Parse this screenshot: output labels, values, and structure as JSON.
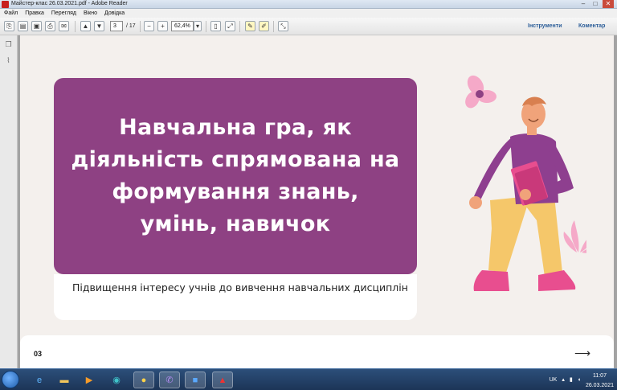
{
  "window": {
    "title": "Майстер-клас 26.03.2021.pdf - Adobe Reader",
    "controls": [
      "–",
      "□",
      "✕"
    ]
  },
  "menu": [
    "Файл",
    "Правка",
    "Перегляд",
    "Вікно",
    "Довідка"
  ],
  "toolbar": {
    "page_current": "3",
    "page_total": "/ 17",
    "zoom": "62,4%",
    "tools_label": "Інструменти",
    "comment_label": "Коментар"
  },
  "slide": {
    "title": "Навчальна гра, як діяльність спрямована на формування знань, умінь, навичок",
    "subtitle": "Підвищення інтересу учнів до вивчення навчальних дисциплін",
    "page_number": "03",
    "next_arrow": "⟶"
  },
  "colors": {
    "accent_purple": "#8e4183",
    "page_bg": "#f4f0ed",
    "figure_pants": "#f5c76a",
    "figure_shoes": "#e84e8f",
    "flower_pink": "#f5a9c8"
  },
  "taskbar": {
    "lang": "UK",
    "time": "11:07",
    "date": "26.03.2021"
  }
}
